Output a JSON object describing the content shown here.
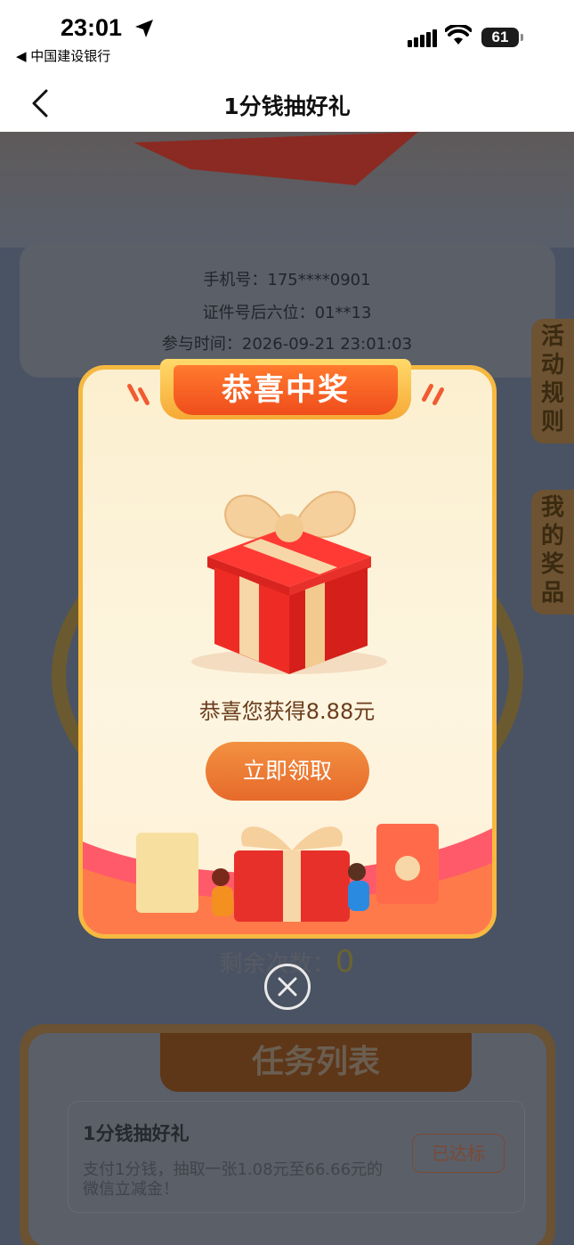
{
  "status_bar": {
    "time": "23:01",
    "back_app": "◀ 中国建设银行",
    "battery": "61"
  },
  "nav": {
    "title": "1分钱抽好礼"
  },
  "info": {
    "phone": "手机号：175****0901",
    "id_suffix": "证件号后六位：01**13",
    "join_time": "参与时间：2026-09-21 23:01:03"
  },
  "side_tabs": [
    {
      "label": "活动规则"
    },
    {
      "label": "我的奖品"
    }
  ],
  "remaining": {
    "label": "剩余次数：",
    "count": "0"
  },
  "tasks": {
    "header": "任务列表",
    "items": [
      {
        "title": "1分钱抽好礼",
        "desc": "支付1分钱，抽取一张1.08元至66.66元的微信立减金！",
        "button": "已达标"
      }
    ]
  },
  "modal": {
    "header": "恭喜中奖",
    "message": "恭喜您获得8.88元",
    "claim_button": "立即领取"
  },
  "colors": {
    "modal_border": "#f6b940",
    "header_red": "#f04d1c",
    "claim_orange": "#e66a2b",
    "gift_red": "#ee2c25",
    "ribbon": "#f7d7a7"
  }
}
